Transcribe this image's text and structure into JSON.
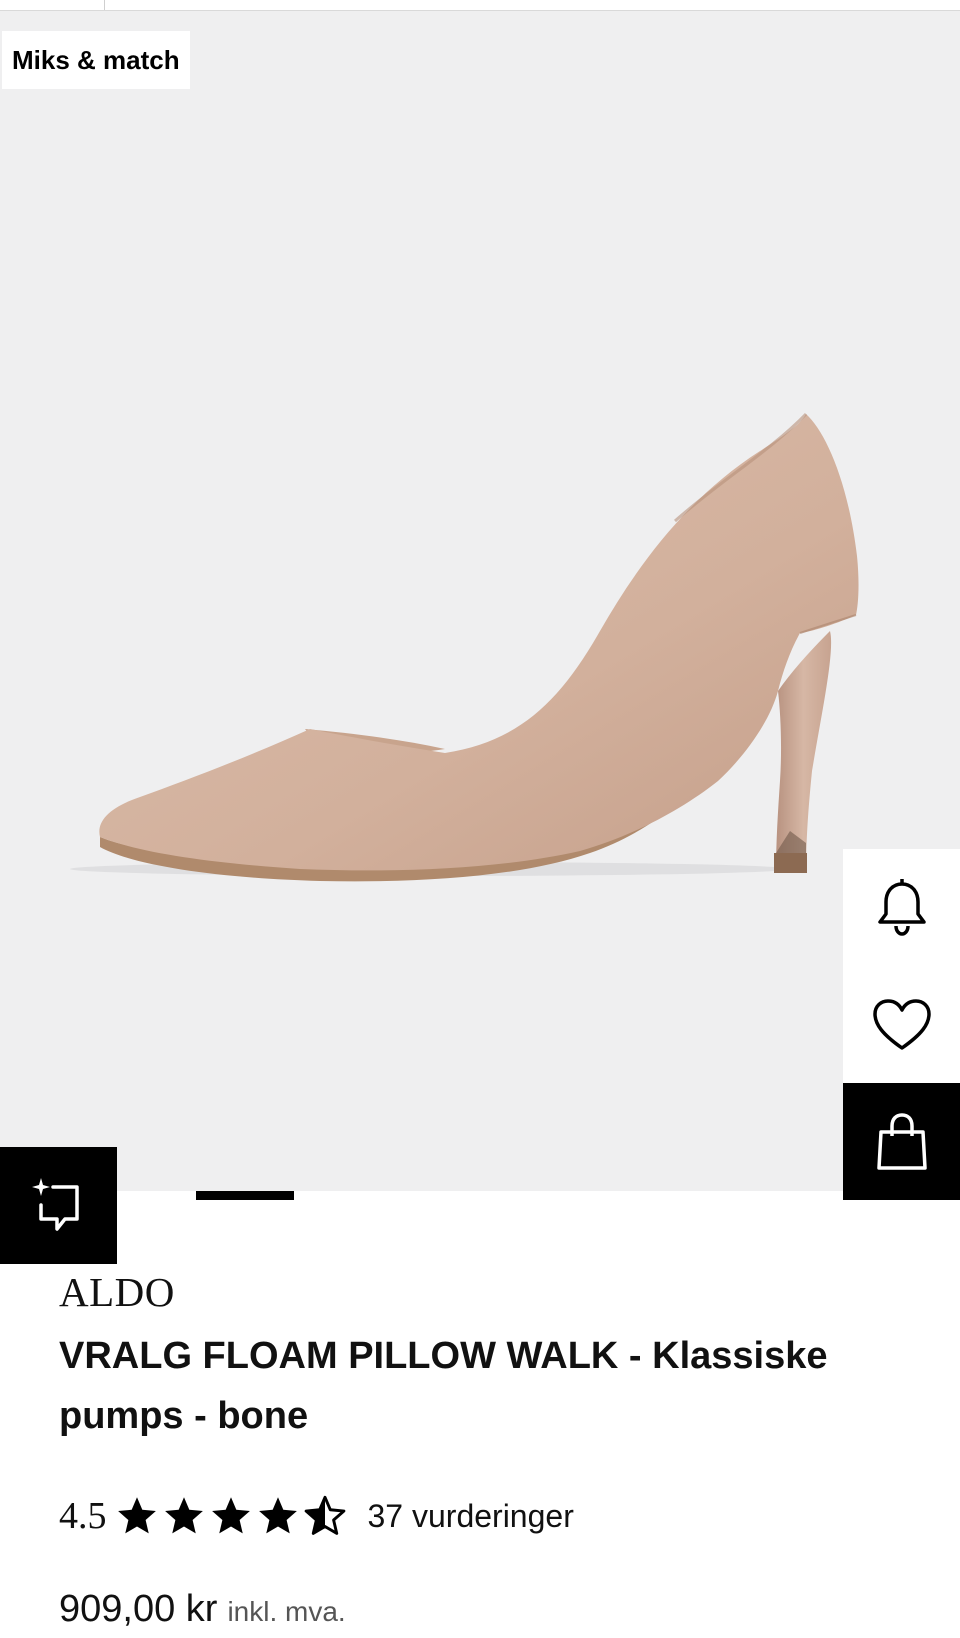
{
  "gallery": {
    "badge": "Miks & match",
    "image_alt": "ALDO VRALG FLOAM PILLOW WALK pumps bone",
    "active_slide": 2,
    "slide_count": 7
  },
  "actions": {
    "notify_icon": "bell-icon",
    "wishlist_icon": "heart-icon",
    "cart_icon": "shopping-bag-icon",
    "similar_icon": "sparkle-chat-icon"
  },
  "product": {
    "brand": "ALDO",
    "title": "VRALG FLOAM PILLOW WALK - Klassiske pumps - bone",
    "rating": {
      "value": "4.5",
      "stars": 4.5,
      "max_stars": 5,
      "count_label": "37 vurderinger"
    },
    "price": "909,00 kr",
    "price_note": "inkl. mva."
  },
  "colors": {
    "gallery_bg": "#efeff0",
    "shoe": "#d4b3a0",
    "accent_dark": "#000000"
  }
}
